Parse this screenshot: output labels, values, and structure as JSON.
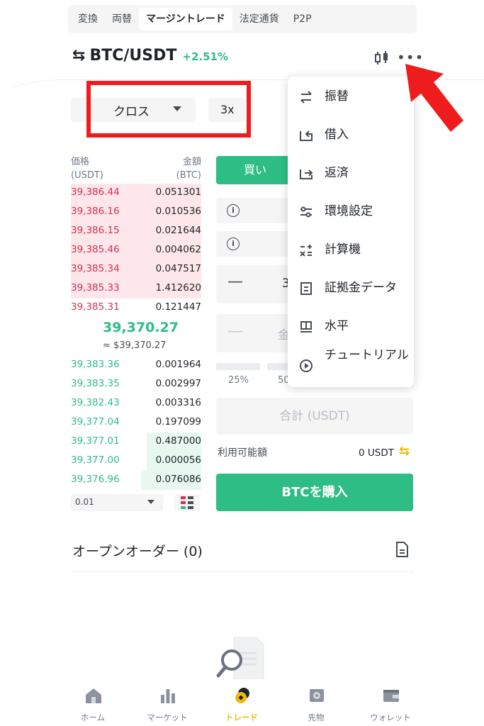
{
  "tabs": [
    {
      "label": "変換"
    },
    {
      "label": "両替"
    },
    {
      "label": "マージントレード",
      "active": true
    },
    {
      "label": "法定通貨"
    },
    {
      "label": "P2P"
    }
  ],
  "pair": {
    "symbol": "BTC/USDT",
    "change": "+2.51%",
    "swap_icon": "⇆"
  },
  "margin": {
    "mode": "クロス",
    "leverage": "3x"
  },
  "orderbook": {
    "price_header": "価格",
    "price_unit": "(USDT)",
    "amount_header": "金額",
    "amount_unit": "(BTC)",
    "asks": [
      {
        "price": "39,386.44",
        "amount": "0.051301",
        "depth": 1.0
      },
      {
        "price": "39,386.16",
        "amount": "0.010536",
        "depth": 1.0
      },
      {
        "price": "39,386.15",
        "amount": "0.021644",
        "depth": 1.0
      },
      {
        "price": "39,385.46",
        "amount": "0.004062",
        "depth": 1.0
      },
      {
        "price": "39,385.34",
        "amount": "0.047517",
        "depth": 1.0
      },
      {
        "price": "39,385.33",
        "amount": "1.412620",
        "depth": 1.0
      },
      {
        "price": "39,385.31",
        "amount": "0.121447",
        "depth": 0.0
      }
    ],
    "mid_price": "39,370.27",
    "mid_fiat": "≈ $39,370.27",
    "bids": [
      {
        "price": "39,383.36",
        "amount": "0.001964",
        "depth": 0.0
      },
      {
        "price": "39,383.35",
        "amount": "0.002997",
        "depth": 0.0
      },
      {
        "price": "39,382.43",
        "amount": "0.003316",
        "depth": 0.0
      },
      {
        "price": "39,377.04",
        "amount": "0.197099",
        "depth": 0.0
      },
      {
        "price": "39,377.01",
        "amount": "0.487000",
        "depth": 0.42
      },
      {
        "price": "39,377.00",
        "amount": "0.000056",
        "depth": 0.42
      },
      {
        "price": "39,376.96",
        "amount": "0.076086",
        "depth": 0.46
      }
    ],
    "depth_value": "0.01"
  },
  "form": {
    "buy_tab": "買い",
    "amount_partial": "3",
    "price_partial": "金",
    "pct_25": "25%",
    "pct_50": "50",
    "total_placeholder": "合計 (USDT)",
    "available_label": "利用可能額",
    "available_value": "0 USDT",
    "buy_button": "BTCを購入"
  },
  "open_orders": {
    "label": "オープンオーダー (0)"
  },
  "menu": {
    "items": [
      {
        "label": "振替",
        "icon": "transfer-icon"
      },
      {
        "label": "借入",
        "icon": "borrow-icon"
      },
      {
        "label": "返済",
        "icon": "repay-icon"
      },
      {
        "label": "環境設定",
        "icon": "settings-sliders-icon"
      },
      {
        "label": "計算機",
        "icon": "calculator-icon"
      },
      {
        "label": "証拠金データ",
        "icon": "margin-data-icon"
      },
      {
        "label": "水平",
        "icon": "level-icon"
      },
      {
        "label": "チュートリアル",
        "icon": "tutorial-play-icon"
      }
    ]
  },
  "bottom_nav": [
    {
      "label": "ホーム",
      "icon": "home-icon"
    },
    {
      "label": "マーケット",
      "icon": "market-bars-icon"
    },
    {
      "label": "トレード",
      "icon": "trade-coins-icon",
      "active": true
    },
    {
      "label": "先物",
      "icon": "futures-icon"
    },
    {
      "label": "ウォレット",
      "icon": "wallet-icon"
    }
  ],
  "colors": {
    "green": "#2ebd85",
    "red": "#d9304f",
    "yellow": "#f0b90b",
    "annotation_red": "#ee1c1c"
  }
}
